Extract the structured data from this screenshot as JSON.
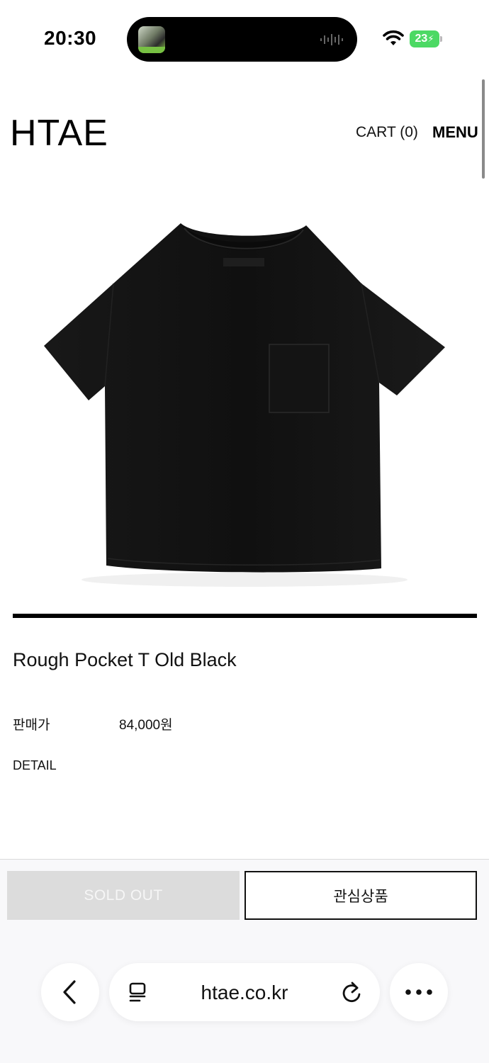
{
  "status_bar": {
    "time": "20:30",
    "battery_level": "23"
  },
  "header": {
    "logo": "HTAE",
    "cart_label": "CART (0)",
    "menu_label": "MENU"
  },
  "product": {
    "name": "Rough Pocket T Old Black",
    "price_label": "판매가",
    "price_value": "84,000원",
    "detail_label": "DETAIL"
  },
  "actions": {
    "sold_out_label": "SOLD OUT",
    "wishlist_label": "관심상품"
  },
  "browser": {
    "url": "htae.co.kr"
  },
  "icons": {
    "wifi": "wifi-icon",
    "battery": "battery-icon",
    "back": "chevron-left-icon",
    "reader": "reader-mode-icon",
    "reload": "reload-icon",
    "more": "more-icon"
  },
  "colors": {
    "battery": "#4cd964",
    "sold_out_bg": "#dcdcdc",
    "text": "#111111"
  }
}
